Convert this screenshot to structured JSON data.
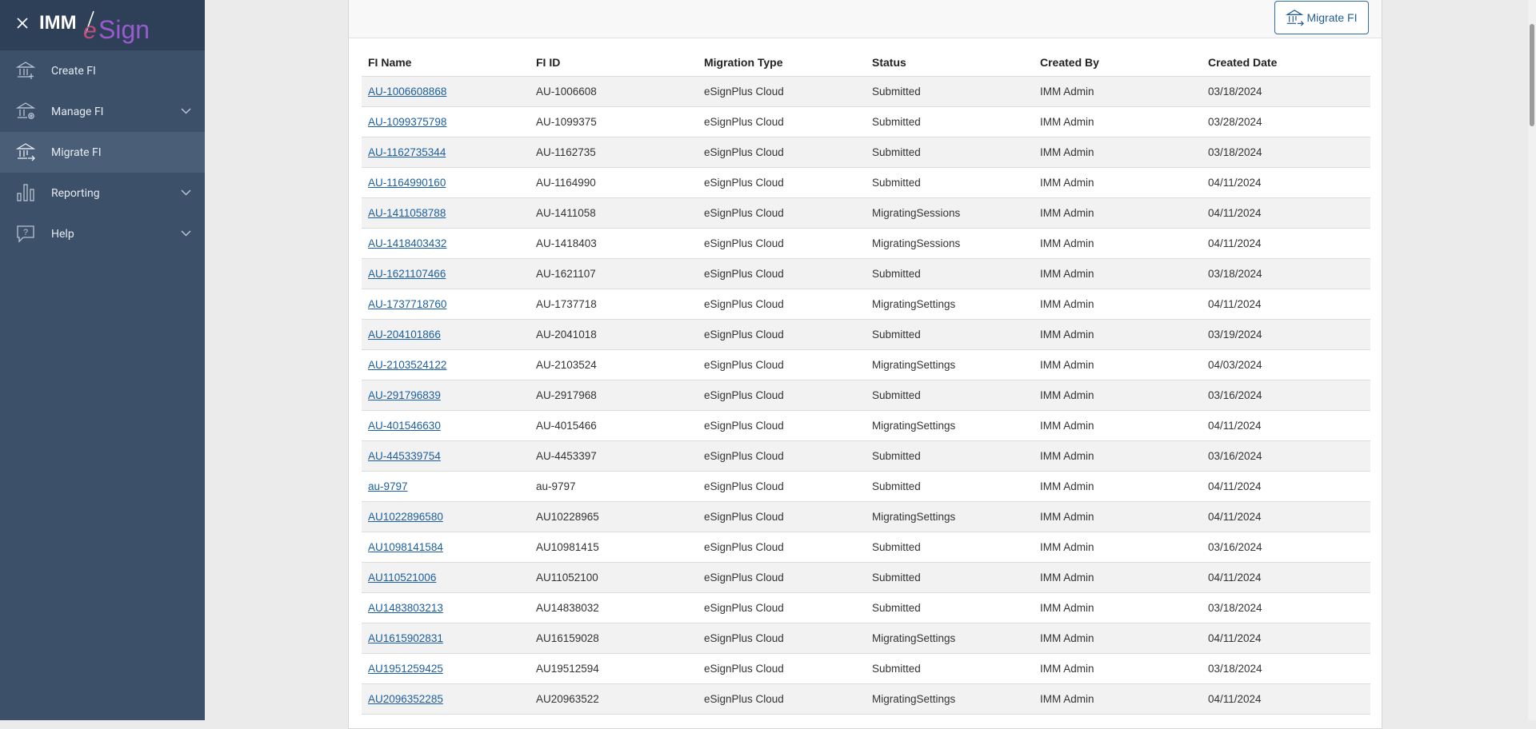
{
  "app": {
    "logo_text": "IMM eSign",
    "close_icon": "close-icon"
  },
  "sidebar": {
    "items": [
      {
        "label": "Create FI",
        "icon": "bank-icon",
        "expandable": false,
        "active": false
      },
      {
        "label": "Manage FI",
        "icon": "bank-gear-icon",
        "expandable": true,
        "active": false
      },
      {
        "label": "Migrate FI",
        "icon": "bank-arrow-icon",
        "expandable": false,
        "active": true
      },
      {
        "label": "Reporting",
        "icon": "bar-chart-icon",
        "expandable": true,
        "active": false
      },
      {
        "label": "Help",
        "icon": "help-icon",
        "expandable": true,
        "active": false
      }
    ]
  },
  "toolbar": {
    "migrate_label": "Migrate FI"
  },
  "table": {
    "columns": [
      "FI Name",
      "FI ID",
      "Migration Type",
      "Status",
      "Created By",
      "Created Date"
    ],
    "rows": [
      [
        "AU-1006608868",
        "AU-1006608",
        "eSignPlus Cloud",
        "Submitted",
        "IMM Admin",
        "03/18/2024"
      ],
      [
        "AU-1099375798",
        "AU-1099375",
        "eSignPlus Cloud",
        "Submitted",
        "IMM Admin",
        "03/28/2024"
      ],
      [
        "AU-1162735344",
        "AU-1162735",
        "eSignPlus Cloud",
        "Submitted",
        "IMM Admin",
        "03/18/2024"
      ],
      [
        "AU-1164990160",
        "AU-1164990",
        "eSignPlus Cloud",
        "Submitted",
        "IMM Admin",
        "04/11/2024"
      ],
      [
        "AU-1411058788",
        "AU-1411058",
        "eSignPlus Cloud",
        "MigratingSessions",
        "IMM Admin",
        "04/11/2024"
      ],
      [
        "AU-1418403432",
        "AU-1418403",
        "eSignPlus Cloud",
        "MigratingSessions",
        "IMM Admin",
        "04/11/2024"
      ],
      [
        "AU-1621107466",
        "AU-1621107",
        "eSignPlus Cloud",
        "Submitted",
        "IMM Admin",
        "03/18/2024"
      ],
      [
        "AU-1737718760",
        "AU-1737718",
        "eSignPlus Cloud",
        "MigratingSettings",
        "IMM Admin",
        "04/11/2024"
      ],
      [
        "AU-204101866",
        "AU-2041018",
        "eSignPlus Cloud",
        "Submitted",
        "IMM Admin",
        "03/19/2024"
      ],
      [
        "AU-2103524122",
        "AU-2103524",
        "eSignPlus Cloud",
        "MigratingSettings",
        "IMM Admin",
        "04/03/2024"
      ],
      [
        "AU-291796839",
        "AU-2917968",
        "eSignPlus Cloud",
        "Submitted",
        "IMM Admin",
        "03/16/2024"
      ],
      [
        "AU-401546630",
        "AU-4015466",
        "eSignPlus Cloud",
        "MigratingSettings",
        "IMM Admin",
        "04/11/2024"
      ],
      [
        "AU-445339754",
        "AU-4453397",
        "eSignPlus Cloud",
        "Submitted",
        "IMM Admin",
        "03/16/2024"
      ],
      [
        "au-9797",
        "au-9797",
        "eSignPlus Cloud",
        "Submitted",
        "IMM Admin",
        "04/11/2024"
      ],
      [
        "AU1022896580",
        "AU10228965",
        "eSignPlus Cloud",
        "MigratingSettings",
        "IMM Admin",
        "04/11/2024"
      ],
      [
        "AU1098141584",
        "AU10981415",
        "eSignPlus Cloud",
        "Submitted",
        "IMM Admin",
        "03/16/2024"
      ],
      [
        "AU110521006",
        "AU11052100",
        "eSignPlus Cloud",
        "Submitted",
        "IMM Admin",
        "04/11/2024"
      ],
      [
        "AU1483803213",
        "AU14838032",
        "eSignPlus Cloud",
        "Submitted",
        "IMM Admin",
        "03/18/2024"
      ],
      [
        "AU1615902831",
        "AU16159028",
        "eSignPlus Cloud",
        "MigratingSettings",
        "IMM Admin",
        "04/11/2024"
      ],
      [
        "AU1951259425",
        "AU19512594",
        "eSignPlus Cloud",
        "Submitted",
        "IMM Admin",
        "03/18/2024"
      ],
      [
        "AU2096352285",
        "AU20963522",
        "eSignPlus Cloud",
        "MigratingSettings",
        "IMM Admin",
        "04/11/2024"
      ]
    ]
  },
  "colors": {
    "sidebar_bg": "#3c5069",
    "sidebar_header_bg": "#2e4058",
    "link": "#1b5fa0",
    "accent": "#2f6ea5"
  }
}
